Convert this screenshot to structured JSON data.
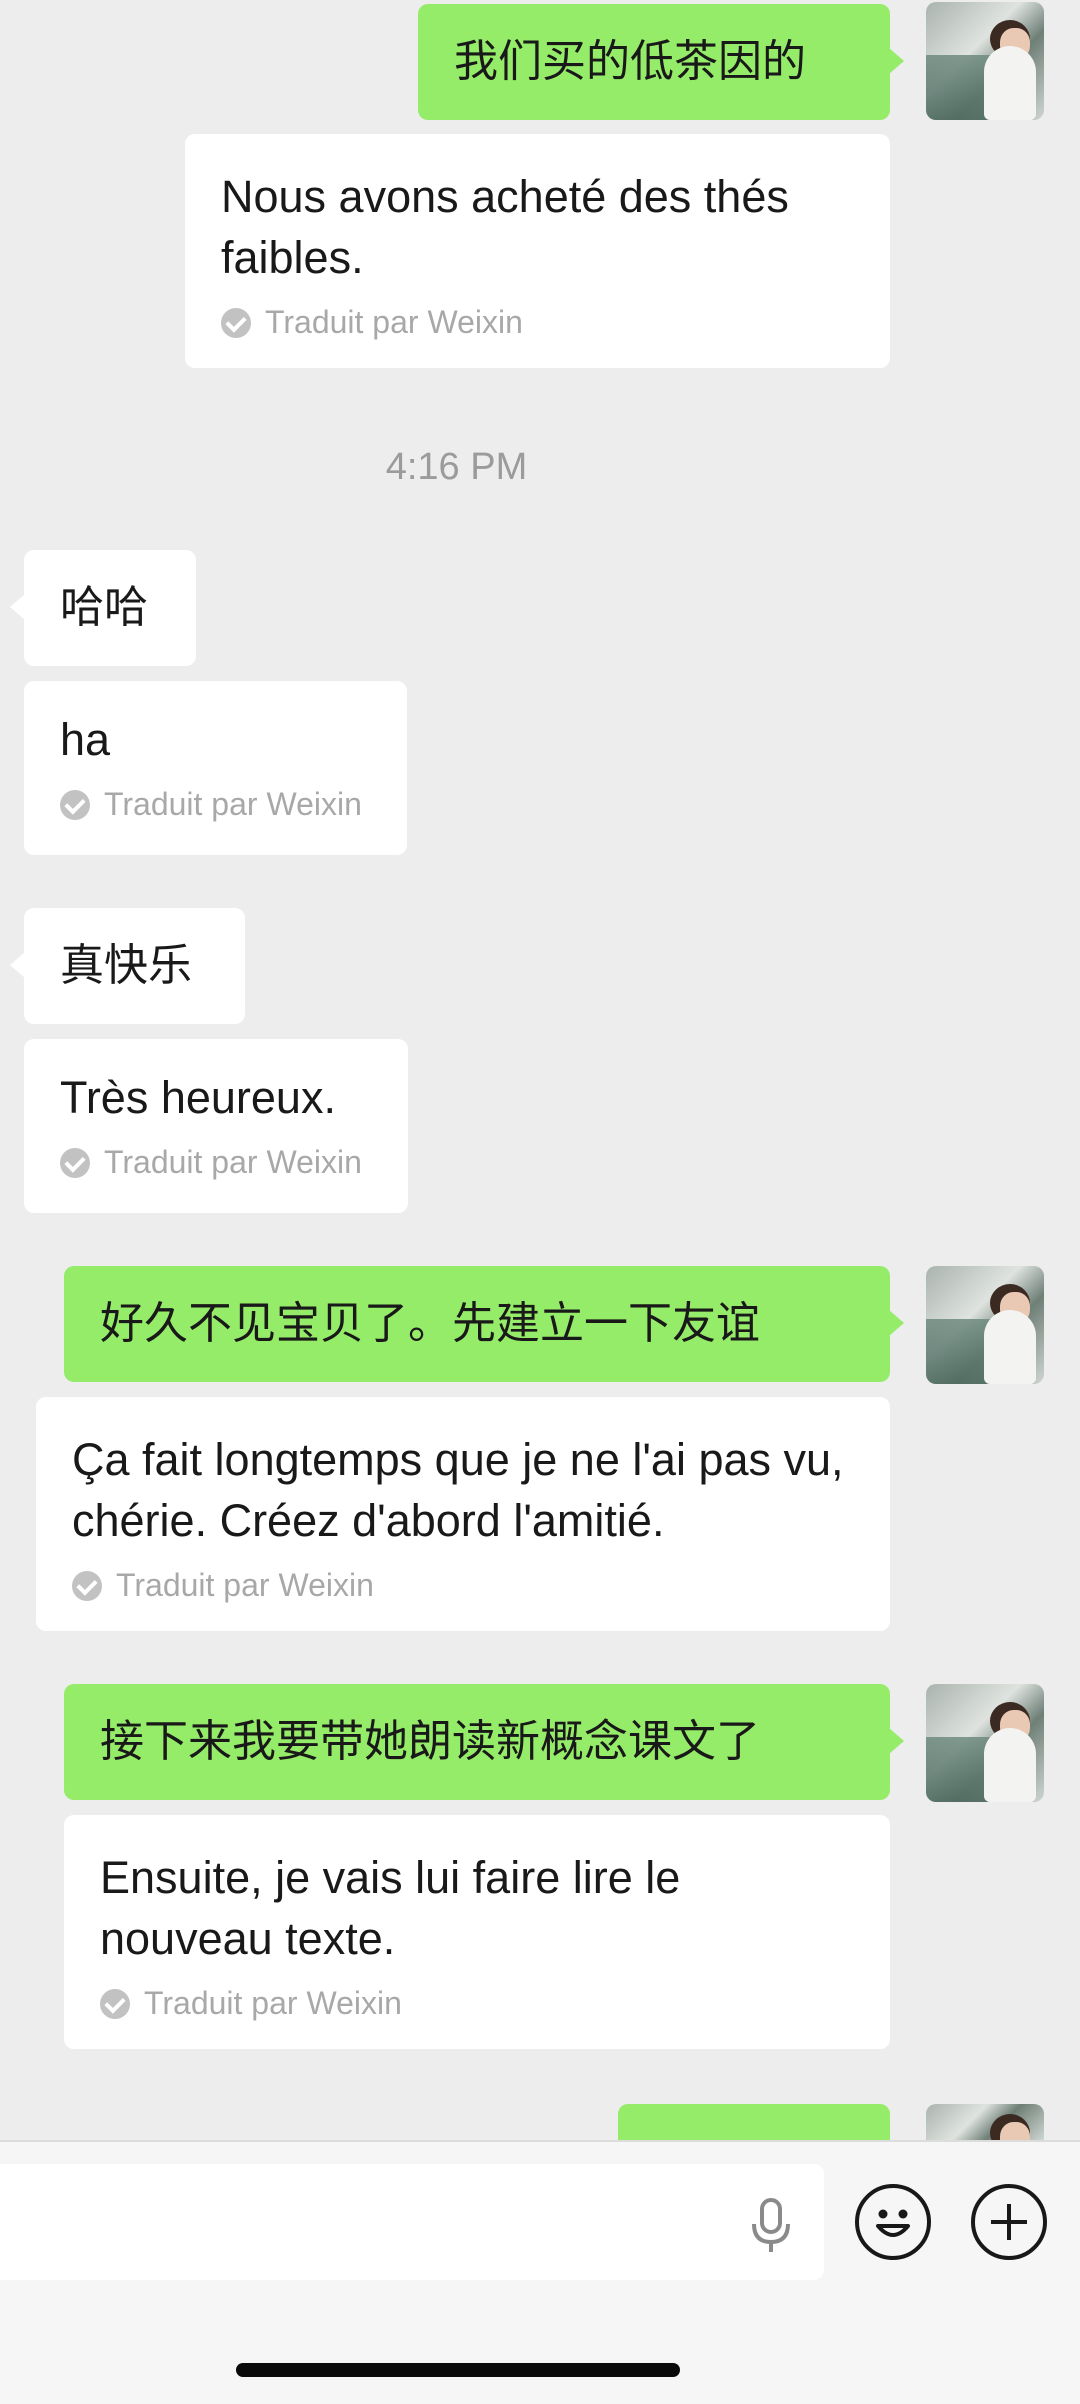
{
  "messages": [
    {
      "side": "right",
      "original": "我们买的低茶因的",
      "translation": "Nous avons acheté des thés faibles.",
      "credit": "Traduit par Weixin"
    },
    {
      "timestamp": "4:16 PM"
    },
    {
      "side": "left",
      "original": "哈哈",
      "translation": "ha",
      "credit": "Traduit par Weixin"
    },
    {
      "side": "left",
      "original": "真快乐",
      "translation": "Très heureux.",
      "credit": "Traduit par Weixin"
    },
    {
      "side": "right",
      "original": "好久不见宝贝了。先建立一下友谊",
      "translation": "Ça fait longtemps que je ne l'ai pas vu, chérie. Créez d'abord l'amitié.",
      "credit": "Traduit par Weixin"
    },
    {
      "side": "right",
      "original": "接下来我要带她朗读新概念课文了",
      "translation": "Ensuite, je vais lui faire lire le nouveau texte.",
      "credit": "Traduit par Weixin"
    }
  ],
  "input_bar": {
    "voice_icon": "microphone-icon",
    "emoji_icon": "emoji-icon",
    "more_icon": "plus-circle-icon"
  },
  "colors": {
    "sent_bubble": "#95ec69",
    "received_bubble": "#ffffff",
    "background": "#ededed"
  }
}
